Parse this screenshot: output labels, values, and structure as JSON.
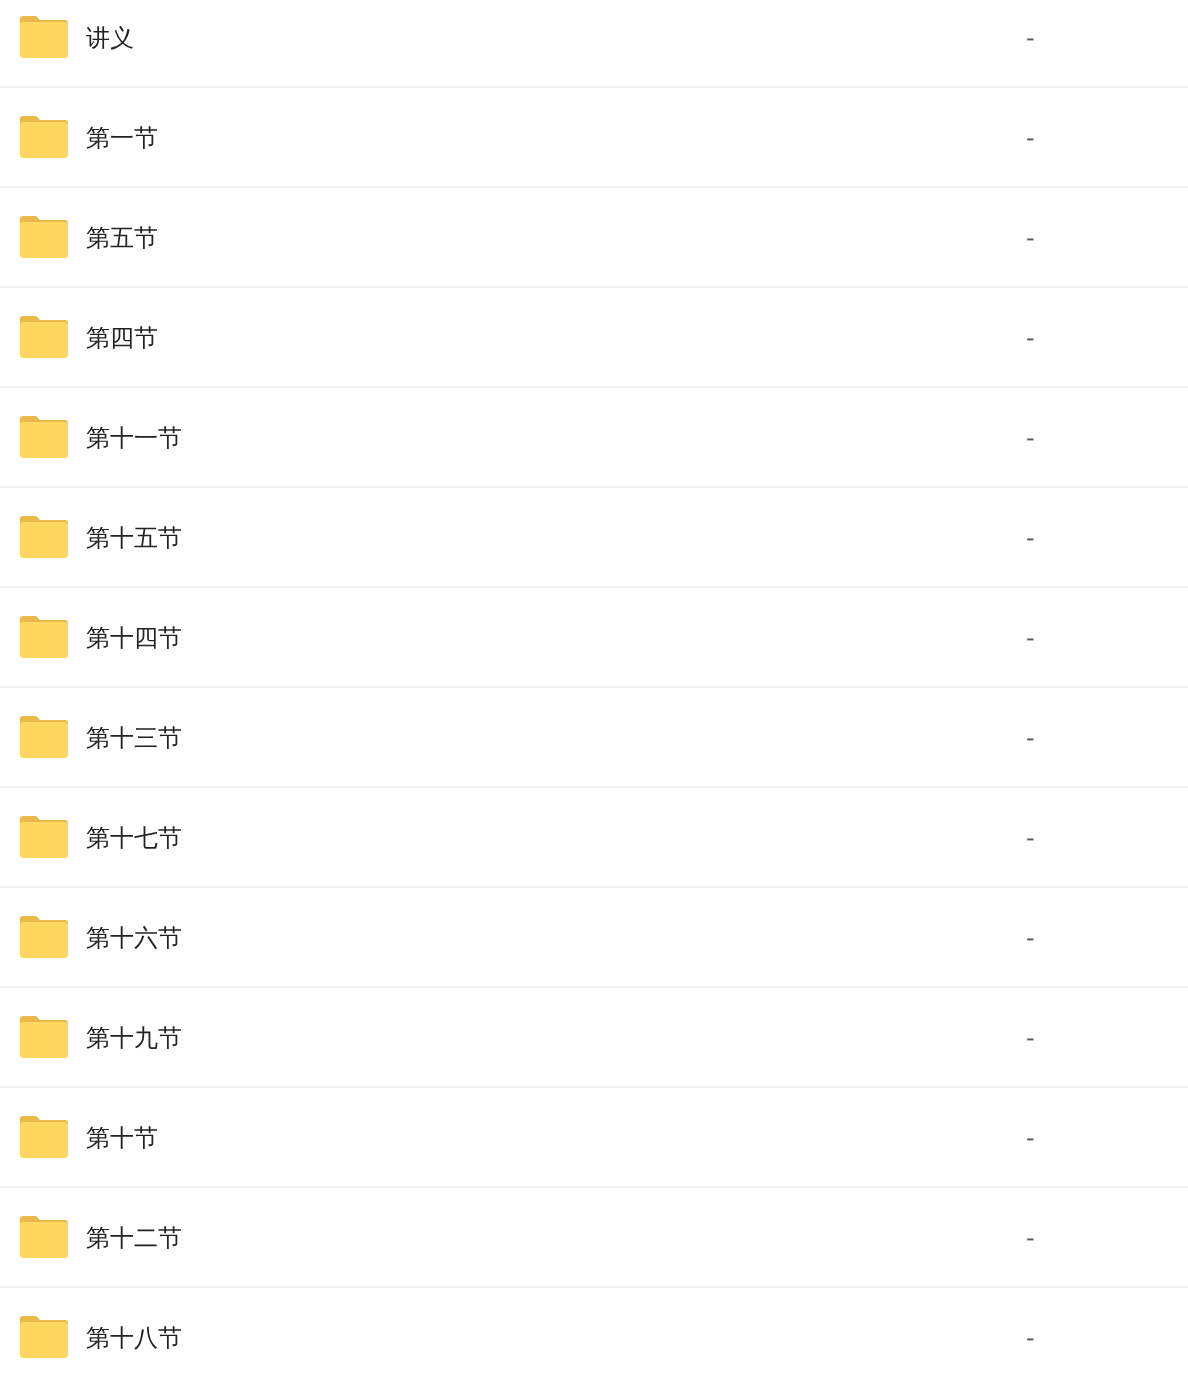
{
  "rows": [
    {
      "name": "讲义",
      "size": "-"
    },
    {
      "name": "第一节",
      "size": "-"
    },
    {
      "name": "第五节",
      "size": "-"
    },
    {
      "name": "第四节",
      "size": "-"
    },
    {
      "name": "第十一节",
      "size": "-"
    },
    {
      "name": "第十五节",
      "size": "-"
    },
    {
      "name": "第十四节",
      "size": "-"
    },
    {
      "name": "第十三节",
      "size": "-"
    },
    {
      "name": "第十七节",
      "size": "-"
    },
    {
      "name": "第十六节",
      "size": "-"
    },
    {
      "name": "第十九节",
      "size": "-"
    },
    {
      "name": "第十节",
      "size": "-"
    },
    {
      "name": "第十二节",
      "size": "-"
    },
    {
      "name": "第十八节",
      "size": "-"
    }
  ]
}
